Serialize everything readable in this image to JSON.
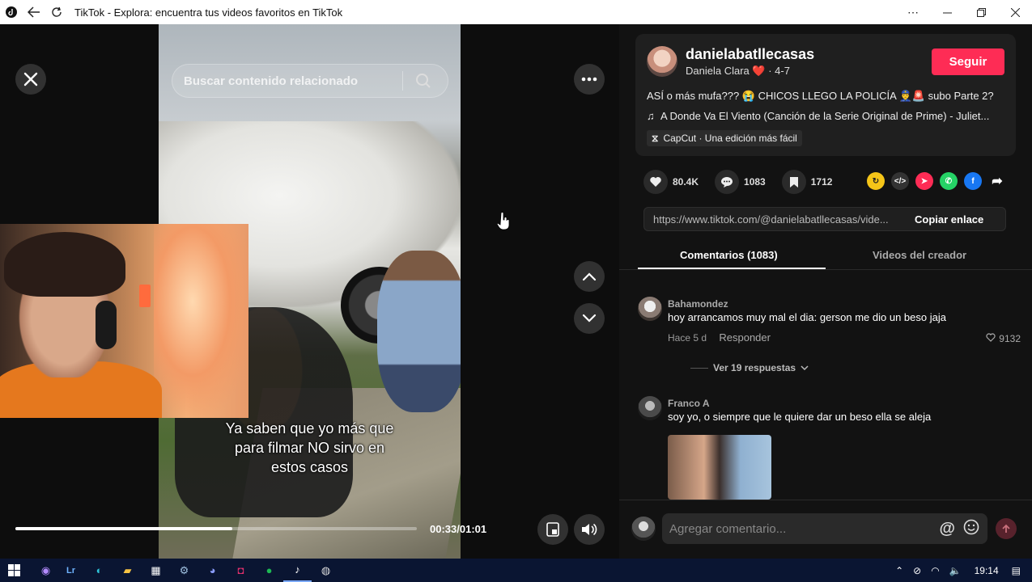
{
  "window": {
    "title": "TikTok - Explora: encuentra tus videos favoritos en TikTok"
  },
  "video": {
    "search_placeholder": "Buscar contenido relacionado",
    "caption_line1": "Ya saben que yo más que",
    "caption_line2": "para filmar NO sirvo en",
    "caption_line3": "estos casos",
    "time": "00:33/01:01",
    "progress_fraction": 0.54
  },
  "creator": {
    "username": "danielabatllecasas",
    "nickname": "Daniela Clara",
    "heart_emoji": "❤️",
    "date": "· 4-7",
    "follow_label": "Seguir"
  },
  "post": {
    "description": "ASÍ o más mufa??? 😭 CHICOS LLEGO LA POLICÍA 👮‍♂️🚨 subo Parte 2?",
    "music": "A Donde Va El Viento (Canción de la Serie Original de Prime) - Juliet...",
    "capcut": "CapCut · Una edición más fácil"
  },
  "stats": {
    "likes": "80.4K",
    "comments": "1083",
    "saves": "1712"
  },
  "share": {
    "url": "https://www.tiktok.com/@danielabatllecasas/vide...",
    "copy_label": "Copiar enlace"
  },
  "tabs": {
    "comments": "Comentarios (1083)",
    "videos": "Videos del creador"
  },
  "comments": [
    {
      "name": "Bahamondez",
      "text": "hoy arrancamos muy mal el dia: gerson me dio un beso jaja",
      "time": "Hace 5 d",
      "reply": "Responder",
      "likes": "9132",
      "view_replies": "Ver 19 respuestas"
    },
    {
      "name": "Franco A",
      "text": "soy yo, o siempre que le quiere dar un beso ella se aleja"
    }
  ],
  "add_comment": {
    "placeholder": "Agregar comentario..."
  },
  "taskbar": {
    "clock": "19:14"
  },
  "colors": {
    "accent": "#fe2c55",
    "panel_bg": "#121212",
    "taskbar_bg": "#0a1532"
  }
}
